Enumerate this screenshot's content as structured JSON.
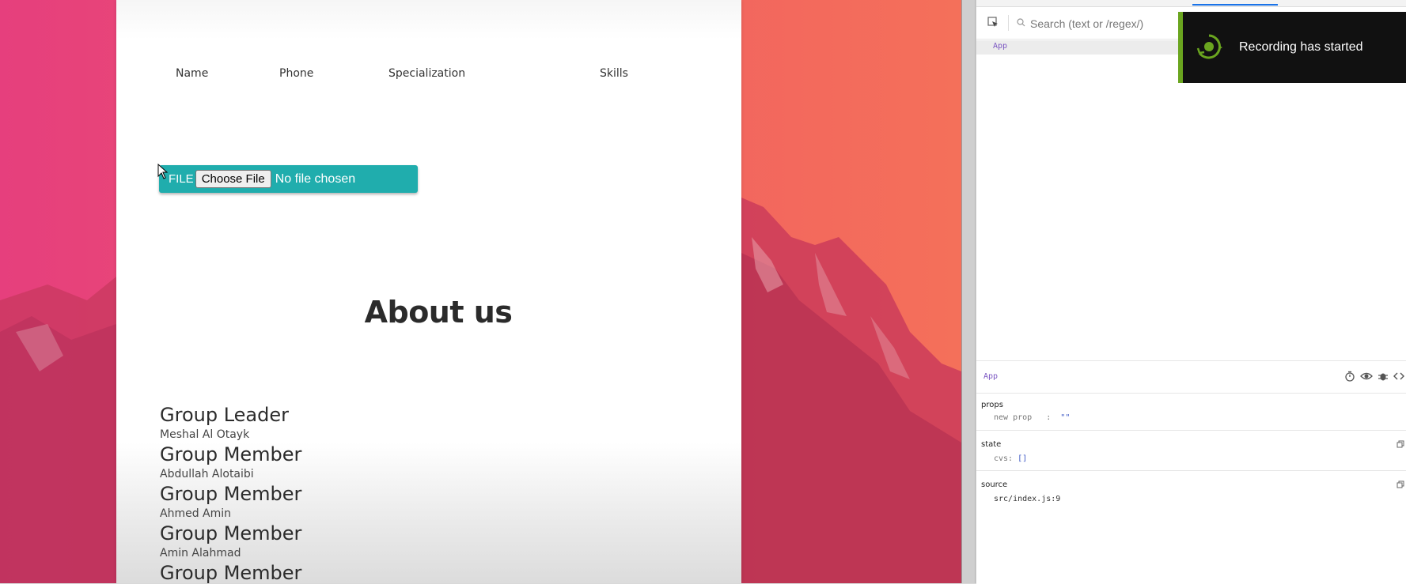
{
  "page": {
    "table_headers": [
      "Name",
      "Phone",
      "Specialization",
      "Skills"
    ],
    "file_input": {
      "label": "FILE",
      "button_label": "Choose File",
      "status": "No file chosen"
    },
    "about_title": "About us",
    "members": [
      {
        "role": "Group Leader",
        "name": "Meshal Al Otayk"
      },
      {
        "role": "Group Member",
        "name": "Abdullah Alotaibi"
      },
      {
        "role": "Group Member",
        "name": "Ahmed Amin"
      },
      {
        "role": "Group Member",
        "name": "Amin Alahmad"
      },
      {
        "role": "Group Member",
        "name": ""
      }
    ]
  },
  "devtools": {
    "search_placeholder": "Search (text or /regex/)",
    "tree_root": "App",
    "toast_message": "Recording has started",
    "selected_component": "App",
    "props": {
      "title": "props",
      "key": "new prop",
      "value": "\"\""
    },
    "state": {
      "title": "state",
      "key": "cvs:",
      "value": "[]"
    },
    "source": {
      "title": "source",
      "value": "src/index.js:9"
    }
  },
  "colors": {
    "file_box": "#20adad",
    "toast_accent": "#6aa51f",
    "component_name": "#7b56c2",
    "accent_tab": "#1a73e8"
  }
}
